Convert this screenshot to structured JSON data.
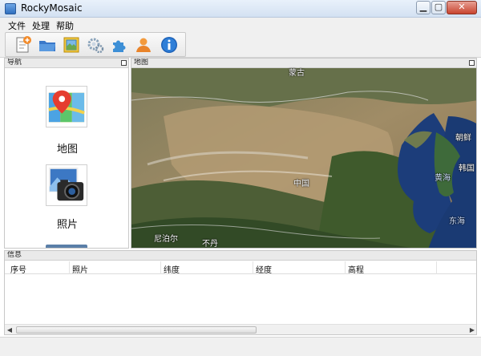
{
  "window": {
    "title": "RockyMosaic"
  },
  "menu": [
    "文件",
    "处理",
    "帮助"
  ],
  "toolbar": [
    "new-project-icon",
    "open-folder-icon",
    "map-tile-icon",
    "settings-gears-icon",
    "plugin-puzzle-icon",
    "user-icon",
    "info-icon"
  ],
  "nav_panel": {
    "title": "导航",
    "items": [
      {
        "label": "地图",
        "icon": "map-pin-icon"
      },
      {
        "label": "照片",
        "icon": "camera-photo-icon"
      }
    ]
  },
  "map_panel": {
    "title": "地图",
    "labels": {
      "mongolia": "蒙古",
      "china": "中国",
      "north_korea": "朝鲜",
      "south_korea": "韩国",
      "yellow_sea": "黄海",
      "east_sea": "东海",
      "nepal": "尼泊尔",
      "bhutan": "不丹"
    }
  },
  "info_panel": {
    "title": "信息",
    "columns": [
      "序号",
      "照片",
      "纬度",
      "经度",
      "高程"
    ]
  },
  "colors": {
    "accent": "#2f6fbf",
    "water": "#1c3d7a",
    "land": "#8a7a55"
  }
}
